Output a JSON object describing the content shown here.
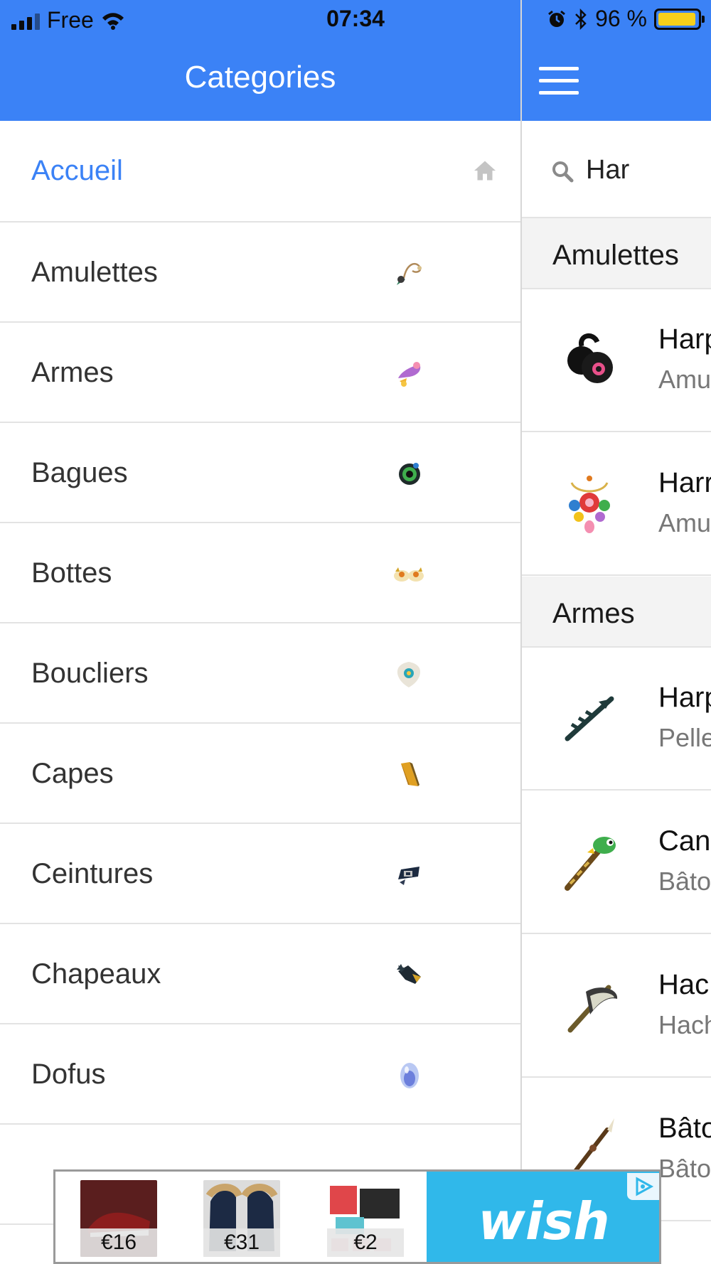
{
  "status_bar": {
    "carrier": "Free",
    "time": "07:34",
    "battery": "96 %",
    "battery_level": 0.96,
    "colors": {
      "bar": "#3b82f6",
      "battery_fill": "#f8d01a"
    }
  },
  "drawer": {
    "title": "Categories",
    "items": [
      {
        "label": "Accueil",
        "icon": "home-icon",
        "active": true
      },
      {
        "label": "Amulettes",
        "icon": "amulet-icon"
      },
      {
        "label": "Armes",
        "icon": "weapon-icon"
      },
      {
        "label": "Bagues",
        "icon": "ring-icon"
      },
      {
        "label": "Bottes",
        "icon": "boots-icon"
      },
      {
        "label": "Boucliers",
        "icon": "shield-icon"
      },
      {
        "label": "Capes",
        "icon": "cape-icon"
      },
      {
        "label": "Ceintures",
        "icon": "belt-icon"
      },
      {
        "label": "Chapeaux",
        "icon": "hat-icon"
      },
      {
        "label": "Dofus",
        "icon": "dofus-egg-icon"
      }
    ]
  },
  "main": {
    "search": {
      "value": "Har"
    },
    "sections": [
      {
        "title": "Amulettes",
        "results": [
          {
            "name": "Harp",
            "sub": "Amu"
          },
          {
            "name": "Harr",
            "sub": "Amu"
          }
        ]
      },
      {
        "title": "Armes",
        "results": [
          {
            "name": "Harp",
            "sub": "Pelle"
          },
          {
            "name": "Can",
            "sub": "Bâto"
          },
          {
            "name": "Hac",
            "sub": "Hach"
          },
          {
            "name": "Bâto",
            "sub": "Bâto"
          }
        ]
      }
    ]
  },
  "ad": {
    "products": [
      {
        "price": "€16"
      },
      {
        "price": "€31"
      },
      {
        "price": "€2"
      }
    ],
    "brand": "wish",
    "brand_color": "#30b8ea"
  }
}
